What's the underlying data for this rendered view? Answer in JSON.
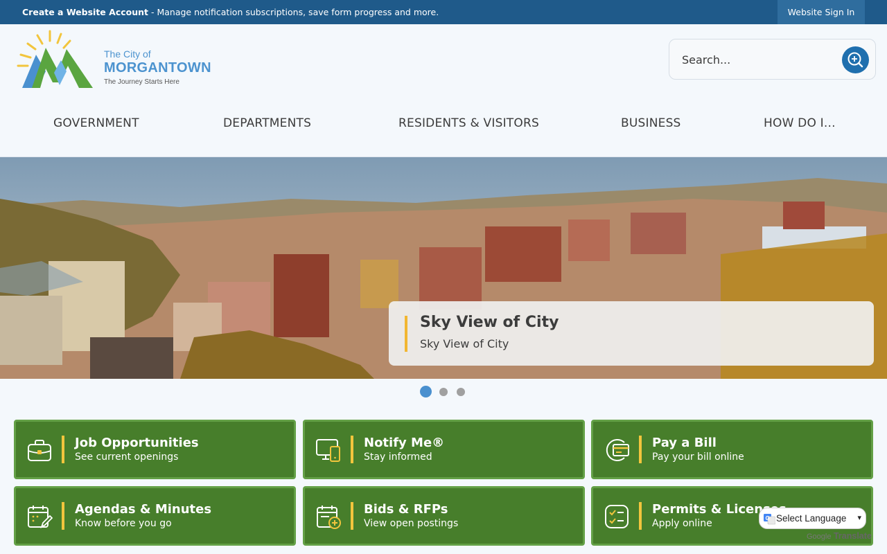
{
  "topbar": {
    "create_account": "Create a Website Account",
    "create_account_desc": " - Manage notification subscriptions, save form progress and more.",
    "sign_in": "Website Sign In"
  },
  "logo": {
    "line1": "The City of",
    "line2": "MORGANTOWN",
    "line3": "The Journey Starts Here"
  },
  "search": {
    "placeholder": "Search..."
  },
  "nav": {
    "items": [
      "GOVERNMENT",
      "DEPARTMENTS",
      "RESIDENTS & VISITORS",
      "BUSINESS",
      "HOW DO I..."
    ]
  },
  "hero": {
    "title": "Sky View of City",
    "subtitle": "Sky View of City",
    "slide_count": 3,
    "active_slide": 1
  },
  "tiles": [
    {
      "title": "Job Opportunities",
      "subtitle": "See current openings",
      "icon": "briefcase-icon"
    },
    {
      "title": "Notify Me®",
      "subtitle": "Stay informed",
      "icon": "devices-icon"
    },
    {
      "title": "Pay a Bill",
      "subtitle": "Pay your bill online",
      "icon": "payment-card-icon"
    },
    {
      "title": "Agendas & Minutes",
      "subtitle": "Know before you go",
      "icon": "calendar-edit-icon"
    },
    {
      "title": "Bids & RFPs",
      "subtitle": "View open postings",
      "icon": "calendar-add-icon"
    },
    {
      "title": "Permits & Licenses",
      "subtitle": "Apply online",
      "icon": "checklist-icon"
    }
  ],
  "translate": {
    "select_label": "Select Language",
    "powered_google": "Google",
    "powered_translate": "Translate"
  },
  "colors": {
    "topbar": "#1f5a8a",
    "tile_green": "#477e2b",
    "accent_yellow": "#f2c53d",
    "link_blue": "#4c93cf"
  }
}
